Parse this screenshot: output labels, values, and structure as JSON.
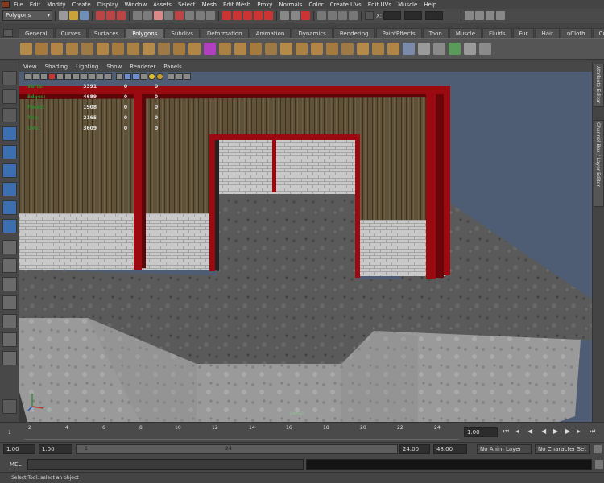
{
  "menubar": {
    "items": [
      "File",
      "Edit",
      "Modify",
      "Create",
      "Display",
      "Window",
      "Assets",
      "Select",
      "Mesh",
      "Edit Mesh",
      "Proxy",
      "Normals",
      "Color",
      "Create UVs",
      "Edit UVs",
      "Muscle",
      "Help"
    ]
  },
  "statusline": {
    "mode": "Polygons",
    "xyz": "X:"
  },
  "shelf": {
    "tabs": [
      "General",
      "Curves",
      "Surfaces",
      "Polygons",
      "Subdivs",
      "Deformation",
      "Animation",
      "Dynamics",
      "Rendering",
      "PaintEffects",
      "Toon",
      "Muscle",
      "Fluids",
      "Fur",
      "Hair",
      "nCloth",
      "Custom"
    ],
    "active_tab": "Polygons"
  },
  "viewport": {
    "menu": [
      "View",
      "Shading",
      "Lighting",
      "Show",
      "Renderer",
      "Panels"
    ],
    "hud": [
      {
        "label": "Verts:",
        "value": "3391",
        "sel": "0",
        "comp": "0"
      },
      {
        "label": "Edges:",
        "value": "4689",
        "sel": "0",
        "comp": "0"
      },
      {
        "label": "Faces:",
        "value": "1908",
        "sel": "0",
        "comp": "0"
      },
      {
        "label": "Tris:",
        "value": "2165",
        "sel": "0",
        "comp": "0"
      },
      {
        "label": "UVs:",
        "value": "3609",
        "sel": "0",
        "comp": "0"
      }
    ],
    "camera": "persp"
  },
  "sidetabs": [
    "Attribute Editor",
    "Channel Box / Layer Editor"
  ],
  "timeslider": {
    "ticks": [
      "2",
      "4",
      "6",
      "8",
      "10",
      "12",
      "14",
      "16",
      "18",
      "20",
      "22",
      "24"
    ],
    "frame_start_marker": "1",
    "current_time": "1.00"
  },
  "rangeslider": {
    "start_time": "1.00",
    "playback_start": "1.00",
    "range_start_label": "1",
    "range_end_label": "24",
    "playback_end": "24.00",
    "end_time": "48.00",
    "anim_layer": "No Anim Layer",
    "character_set": "No Character Set"
  },
  "cmdline": {
    "label": "MEL"
  },
  "helpline": "Select Tool: select an object",
  "colors": {
    "frame_red": "#9b0a10",
    "sky": "#4e5d73",
    "hud_label": "#2f8a2f"
  }
}
